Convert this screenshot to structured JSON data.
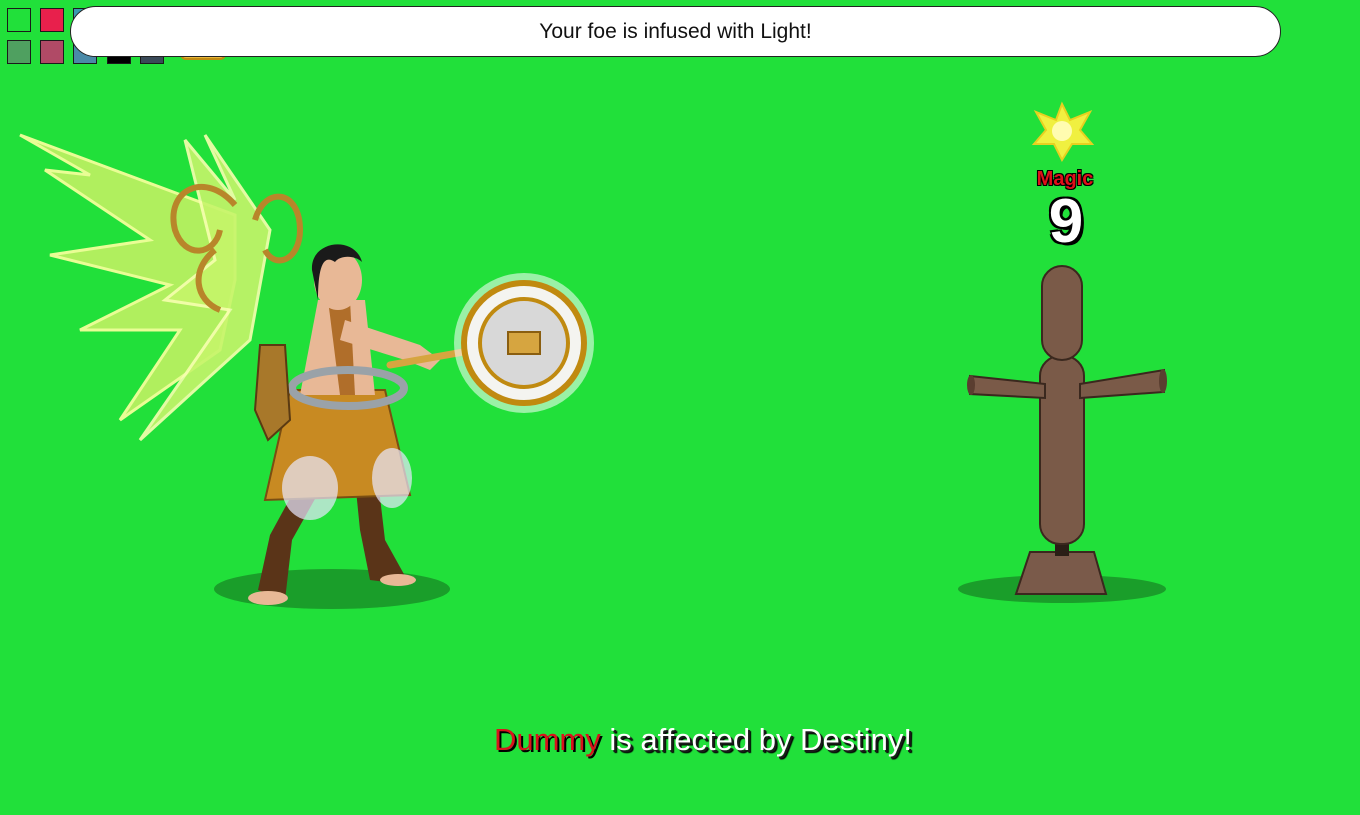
{
  "notification": {
    "text": "Your foe is infused with Light!"
  },
  "toolbar": {
    "swatches": [
      {
        "name": "swatch-green",
        "color": "#21e03a"
      },
      {
        "name": "swatch-red",
        "color": "#e8204c"
      },
      {
        "name": "swatch-teal",
        "color": "#3a9bb0"
      },
      {
        "name": "swatch-sage",
        "color": "#4fa060"
      },
      {
        "name": "swatch-rose",
        "color": "#b04a66"
      },
      {
        "name": "swatch-steel",
        "color": "#4a8aa8"
      },
      {
        "name": "swatch-black",
        "color": "#000000"
      },
      {
        "name": "swatch-slate",
        "color": "#3a4a58"
      }
    ]
  },
  "damage": {
    "label": "Magic",
    "value": "9"
  },
  "battle_message": {
    "target": "Dummy",
    "text": " is affected by Destiny!"
  },
  "colors": {
    "background": "#21e03a",
    "damage_label": "#e0101a",
    "target_name": "#d8141c"
  }
}
